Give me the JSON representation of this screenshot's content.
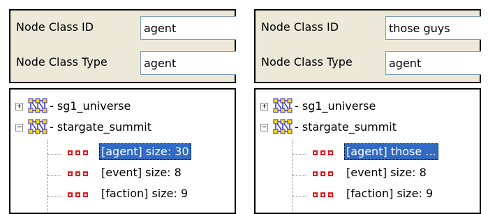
{
  "left": {
    "form": {
      "class_id_label": "Node Class ID",
      "class_id_value": "agent",
      "class_type_label": "Node Class Type",
      "class_type_value": "agent"
    },
    "tree": {
      "roots": [
        {
          "label": "- sg1_universe",
          "expander": "+"
        },
        {
          "label": "- stargate_summit",
          "expander": "−"
        }
      ],
      "children": [
        {
          "label": "[agent] size: 30",
          "selected": true
        },
        {
          "label": "[event] size: 8",
          "selected": false
        },
        {
          "label": "[faction] size: 9",
          "selected": false
        }
      ]
    }
  },
  "right": {
    "form": {
      "class_id_label": "Node Class ID",
      "class_id_value": "those guys",
      "class_type_label": "Node Class Type",
      "class_type_value": "agent"
    },
    "tree": {
      "roots": [
        {
          "label": "- sg1_universe",
          "expander": "+"
        },
        {
          "label": "- stargate_summit",
          "expander": "−"
        }
      ],
      "children": [
        {
          "label": "[agent] those ...",
          "selected": true
        },
        {
          "label": "[event] size: 8",
          "selected": false
        },
        {
          "label": "[faction] size: 9",
          "selected": false
        }
      ]
    }
  },
  "colors": {
    "form_background": "#ece9d8",
    "selection": "#316ac5",
    "node_class_icon": "#e8161a",
    "graph_icon": "#2d2de0"
  },
  "icons": {
    "graph": "graph-network-icon",
    "node_class": "node-class-icon"
  }
}
